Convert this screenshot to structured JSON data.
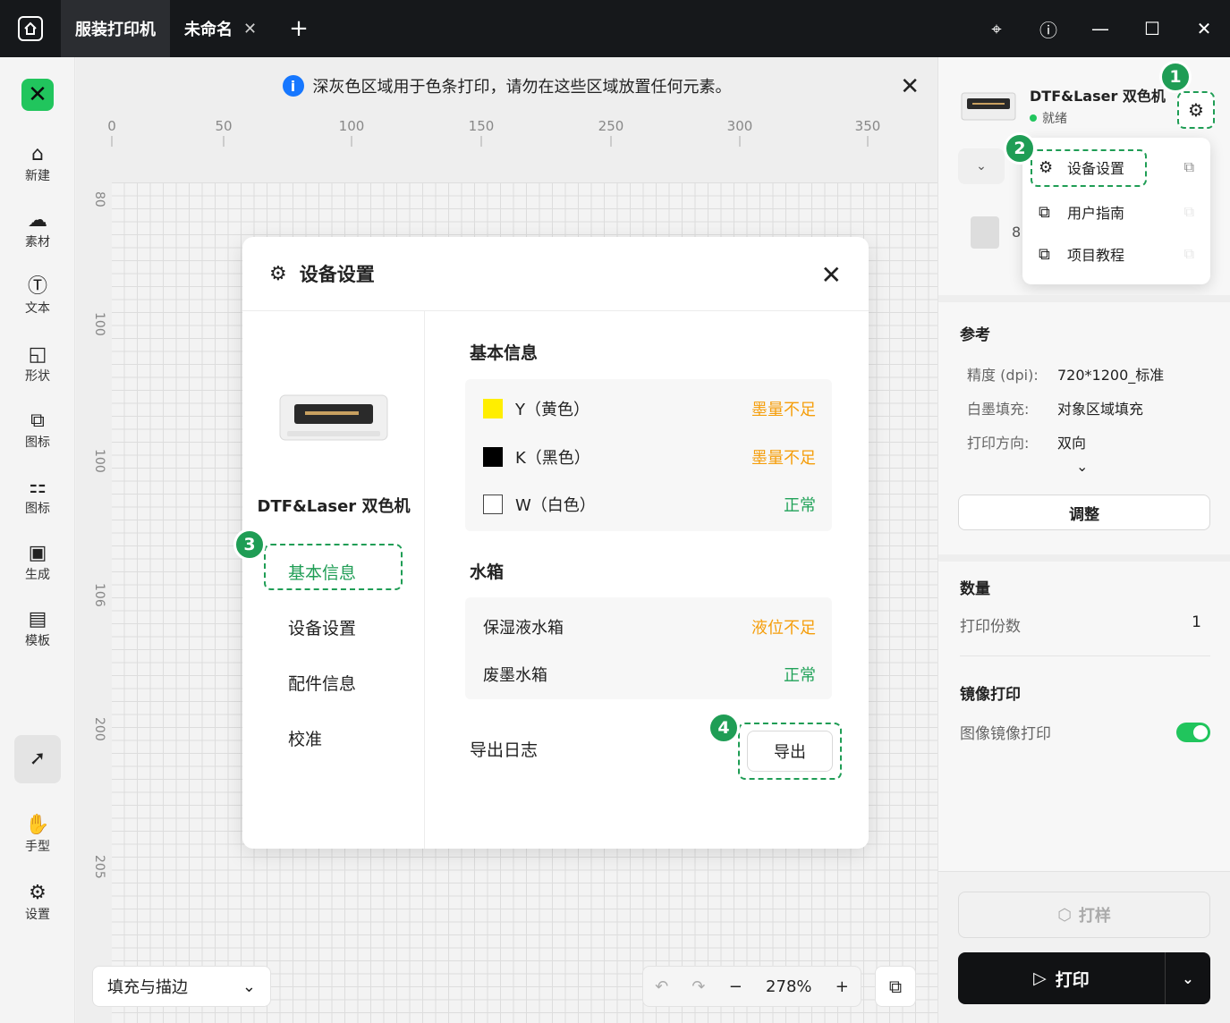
{
  "titlebar": {
    "tabs": [
      {
        "label": "服装打印机",
        "active": true
      },
      {
        "label": "未命名",
        "close": "✕"
      }
    ],
    "add_tab": "+",
    "controls": [
      "pin-icon",
      "info-icon",
      "minimize-icon",
      "maximize-icon",
      "close-icon"
    ]
  },
  "leftbar": {
    "logo": "✕",
    "tools": [
      {
        "label": "新建",
        "icon": "new-icon"
      },
      {
        "label": "素材",
        "icon": "cloud-upload-icon"
      },
      {
        "label": "文本",
        "icon": "text-icon"
      },
      {
        "label": "形状",
        "icon": "shape-icon"
      },
      {
        "label": "图标",
        "icon": "icons-icon"
      },
      {
        "label": "图标",
        "icon": "grid-icon"
      },
      {
        "label": "生成",
        "icon": "generate-icon"
      },
      {
        "label": "模板",
        "icon": "template-icon"
      },
      {
        "label": "",
        "icon": "select-cursor-icon"
      },
      {
        "label": "手型",
        "icon": "hand-icon"
      },
      {
        "label": "设置",
        "icon": "settings-icon"
      }
    ]
  },
  "canvas": {
    "notice": "深灰色区域用于色条打印，请勿在这些区域放置任何元素。",
    "ruler_top": [
      "0",
      "50",
      "100",
      "150",
      "250",
      "300",
      "350"
    ],
    "ruler_left": [
      "80",
      "100",
      "100",
      "106",
      "200",
      "205"
    ],
    "fill_stroke": "填充与描边",
    "zoom": "278%"
  },
  "right_panel": {
    "printer_name": "DTF&Laser 双色机",
    "printer_status": "就绪",
    "menu": [
      {
        "label": "设备设置",
        "icon": "gear-icon"
      },
      {
        "label": "用户指南",
        "icon": "external-link-icon"
      },
      {
        "label": "项目教程",
        "icon": "external-link-icon"
      }
    ],
    "mini_label": "8",
    "reference": {
      "title": "参考",
      "rows": [
        {
          "k": "精度 (dpi):",
          "v": "720*1200_标准"
        },
        {
          "k": "白墨填充:",
          "v": "对象区域填充"
        },
        {
          "k": "打印方向:",
          "v": "双向"
        }
      ],
      "adjust": "调整"
    },
    "quantity": {
      "title": "数量",
      "label": "打印份数",
      "value": "1"
    },
    "mirror": {
      "title": "镜像打印",
      "label": "图像镜像打印",
      "enabled": true
    },
    "proof": "打样",
    "print": "打印"
  },
  "dialog": {
    "title": "设备设置",
    "model": "DTF&Laser 双色机",
    "nav": [
      "基本信息",
      "设备设置",
      "配件信息",
      "校准"
    ],
    "basic_title": "基本信息",
    "inks": [
      {
        "name": "Y（黄色）",
        "color": "#ffee00",
        "status": "墨量不足",
        "state": "warn"
      },
      {
        "name": "K（黑色）",
        "color": "#000000",
        "status": "墨量不足",
        "state": "warn"
      },
      {
        "name": "W（白色）",
        "color": "#ffffff",
        "status": "正常",
        "state": "ok"
      }
    ],
    "tank_title": "水箱",
    "tanks": [
      {
        "name": "保湿液水箱",
        "status": "液位不足",
        "state": "warn"
      },
      {
        "name": "废墨水箱",
        "status": "正常",
        "state": "ok"
      }
    ],
    "export_label": "导出日志",
    "export_button": "导出"
  },
  "badges": [
    "1",
    "2",
    "3",
    "4"
  ],
  "colors": {
    "accent": "#1f9d55",
    "warn": "#f59e0b",
    "ok": "#22a35a",
    "titlebar": "#16181b"
  }
}
